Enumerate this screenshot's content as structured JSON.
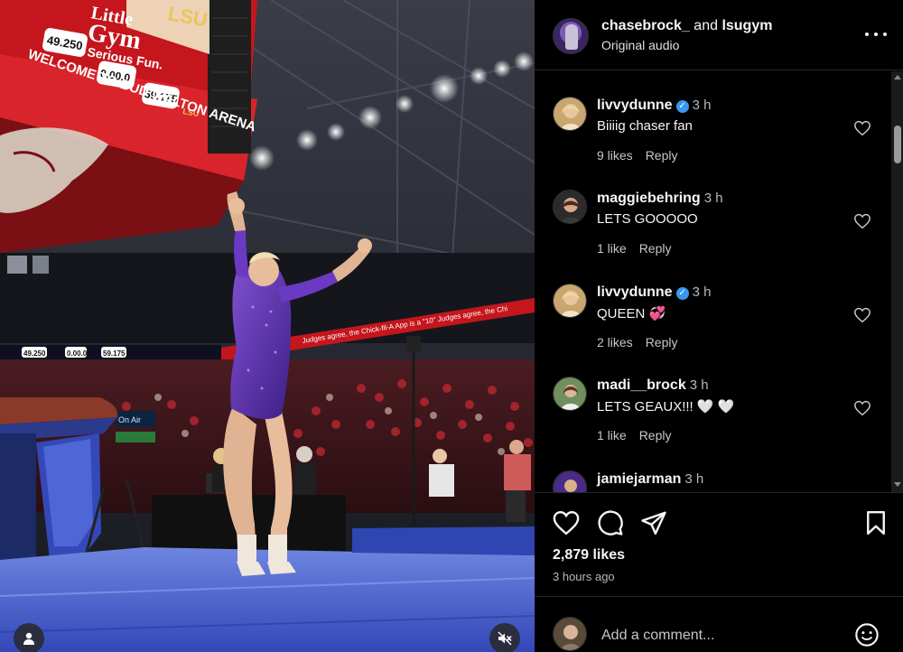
{
  "post": {
    "authors_primary": "chasebrock_",
    "authors_join": " and ",
    "authors_secondary": "lsugym",
    "audio": "Original audio"
  },
  "scoreboard": {
    "brand_line1": "Little",
    "brand_line2": "Gym",
    "brand_line3": "Serious Fun.",
    "score1": "49.250",
    "score2": "0.00.0",
    "score3": "59.175",
    "lsu_tag": "LSU",
    "welcome": "WELCOME TO BUD WALTON ARENA"
  },
  "ribbon": {
    "text": "Judges agree, the Chick-fil-A App is a \"10\"  Judges agree, the Chi",
    "s1": "49.250",
    "s2": "0.00.0",
    "s3": "59.175",
    "onair": "On Air"
  },
  "comments": [
    {
      "user": "livvydunne",
      "verified": true,
      "time": "3 h",
      "text": "Biiiig chaser fan",
      "likes": "9 likes",
      "reply": "Reply"
    },
    {
      "user": "maggiebehring",
      "verified": false,
      "time": "3 h",
      "text": "LETS GOOOOO",
      "likes": "1 like",
      "reply": "Reply"
    },
    {
      "user": "livvydunne",
      "verified": true,
      "time": "3 h",
      "text": "QUEEN 💞",
      "likes": "2 likes",
      "reply": "Reply"
    },
    {
      "user": "madi__brock",
      "verified": false,
      "time": "3 h",
      "text": "LETS GEAUX!!! 🤍 🤍",
      "likes": "1 like",
      "reply": "Reply"
    },
    {
      "user": "jamiejarman",
      "verified": false,
      "time": "3 h",
      "text": "",
      "likes": "",
      "reply": ""
    }
  ],
  "engagement": {
    "likes": "2,879 likes",
    "time_ago": "3 hours ago"
  },
  "comment_box": {
    "placeholder": "Add a comment..."
  },
  "colors": {
    "background": "#000000",
    "text": "#f5f5f5",
    "secondary_text": "#b8b8b8",
    "verified": "#3897f0",
    "lsu_purple": "#4b2a88",
    "arena_red": "#c4161c"
  },
  "icons": {
    "actions": [
      "heart-icon",
      "comment-icon",
      "share-icon",
      "bookmark-icon"
    ],
    "media": [
      "user-tag-icon",
      "muted-speaker-icon"
    ],
    "other": [
      "more-options-icon",
      "verified-badge-icon",
      "emoji-icon"
    ]
  }
}
